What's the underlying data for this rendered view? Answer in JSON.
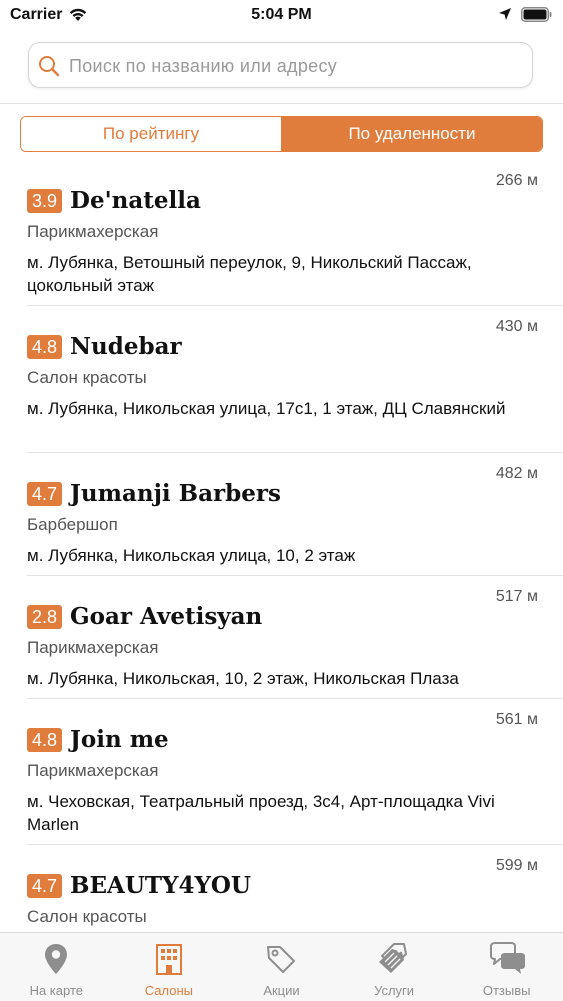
{
  "status_bar": {
    "carrier": "Carrier",
    "time": "5:04 PM"
  },
  "search": {
    "placeholder": "Поиск по названию или адресу",
    "value": ""
  },
  "sort": {
    "options": [
      "По рейтингу",
      "По удаленности"
    ],
    "selected": "По удаленности"
  },
  "salons": [
    {
      "rating": "3.9",
      "name": "De'natella",
      "type": "Парикмахерская",
      "address": "м. Лубянка, Ветошный переулок, 9, Никольский Пассаж, цокольный этаж",
      "distance": "266 м"
    },
    {
      "rating": "4.8",
      "name": "Nudebar",
      "type": "Салон красоты",
      "address": "м. Лубянка, Никольская улица, 17с1, 1 этаж, ДЦ Славянский",
      "distance": "430 м"
    },
    {
      "rating": "4.7",
      "name": "Jumanji Barbers",
      "type": "Барбершоп",
      "address": "м. Лубянка, Никольская улица, 10, 2 этаж",
      "distance": "482 м"
    },
    {
      "rating": "2.8",
      "name": "Goar Avetisyan",
      "type": "Парикмахерская",
      "address": "м. Лубянка, Никольская, 10, 2 этаж, Никольская Плаза",
      "distance": "517 м"
    },
    {
      "rating": "4.8",
      "name": "Join me",
      "type": "Парикмахерская",
      "address": "м. Чеховская, Театральный проезд, 3с4, Арт-площадка Vivi Marlen",
      "distance": "561 м"
    },
    {
      "rating": "4.7",
      "name": "BEAUTY4YOU",
      "type": "Салон красоты",
      "address": "",
      "distance": "599 м"
    }
  ],
  "tabs": [
    {
      "label": "На карте",
      "icon": "map-pin-icon"
    },
    {
      "label": "Салоны",
      "icon": "building-icon",
      "active": true
    },
    {
      "label": "Акции",
      "icon": "tag-icon"
    },
    {
      "label": "Услуги",
      "icon": "price-tags-icon"
    },
    {
      "label": "Отзывы",
      "icon": "chat-bubbles-icon"
    }
  ],
  "colors": {
    "accent": "#e07c3c",
    "inactive": "#8e8e8e"
  }
}
